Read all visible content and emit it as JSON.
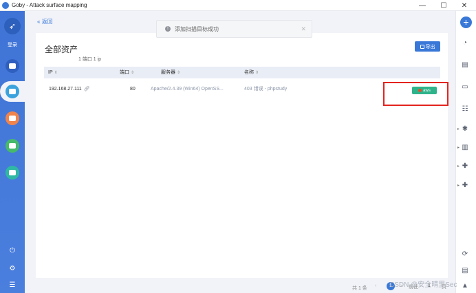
{
  "titlebar": {
    "title": "Goby - Attack surface mapping",
    "minimize": "—",
    "maximize": "☐",
    "close": "✕"
  },
  "sidebar": {
    "login_label": "登录",
    "power_icon": "power-icon",
    "settings_icon": "gear-icon",
    "menu_icon": "menu-icon"
  },
  "nav": {
    "back_label": "返回"
  },
  "toast": {
    "message": "添加扫描目标成功",
    "info": "!",
    "close": "✕"
  },
  "panel": {
    "title": "全部资产",
    "summary": "1 端口 1 ip",
    "export_label": "导出",
    "columns": [
      {
        "label": "IP"
      },
      {
        "label": "端口"
      },
      {
        "label": "服务器"
      },
      {
        "label": "名称"
      }
    ],
    "rows": [
      {
        "ip": "192.168.27.111",
        "port": "80",
        "server": "Apache/2.4.39 (Win64) OpenSS...",
        "name": "403 错误 - phpstudy",
        "tag": "aws"
      }
    ]
  },
  "footer": {
    "total": "共 1 条",
    "page": "1",
    "goto": "前往",
    "goto_page": "1",
    "page_unit": "页"
  },
  "watermark": "CSDN @安全晴里Sec",
  "colors": {
    "accent": "#3a78d8",
    "sidebar": "#4b7fde",
    "tag": "#2fb38a",
    "highlight": "#e3231e"
  }
}
